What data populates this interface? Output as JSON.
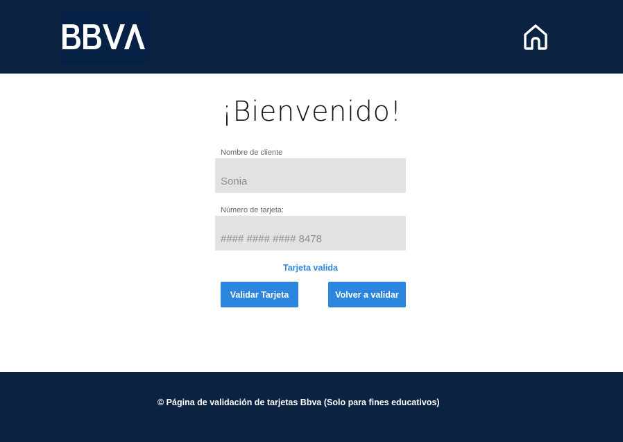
{
  "header": {
    "logo_text": "BBVA",
    "home_icon": "home-icon"
  },
  "main": {
    "title": "¡Bienvenido!",
    "client_field": {
      "label": "Nombre de cliente",
      "placeholder": "Sonia"
    },
    "card_field": {
      "label": "Número de tarjeta:",
      "placeholder": "#### #### #### 8478"
    },
    "status_text": "Tarjeta valida",
    "validate_button": "Validar Tarjeta",
    "revalidate_button": "Volver a validar"
  },
  "footer": {
    "text": "© Página de validación de tarjetas Bbva (Solo para fines educativos)"
  },
  "colors": {
    "header_bg": "#0b2341",
    "logo_bg": "#072146",
    "accent": "#2d86de",
    "field_bg": "#e2e2e2"
  }
}
